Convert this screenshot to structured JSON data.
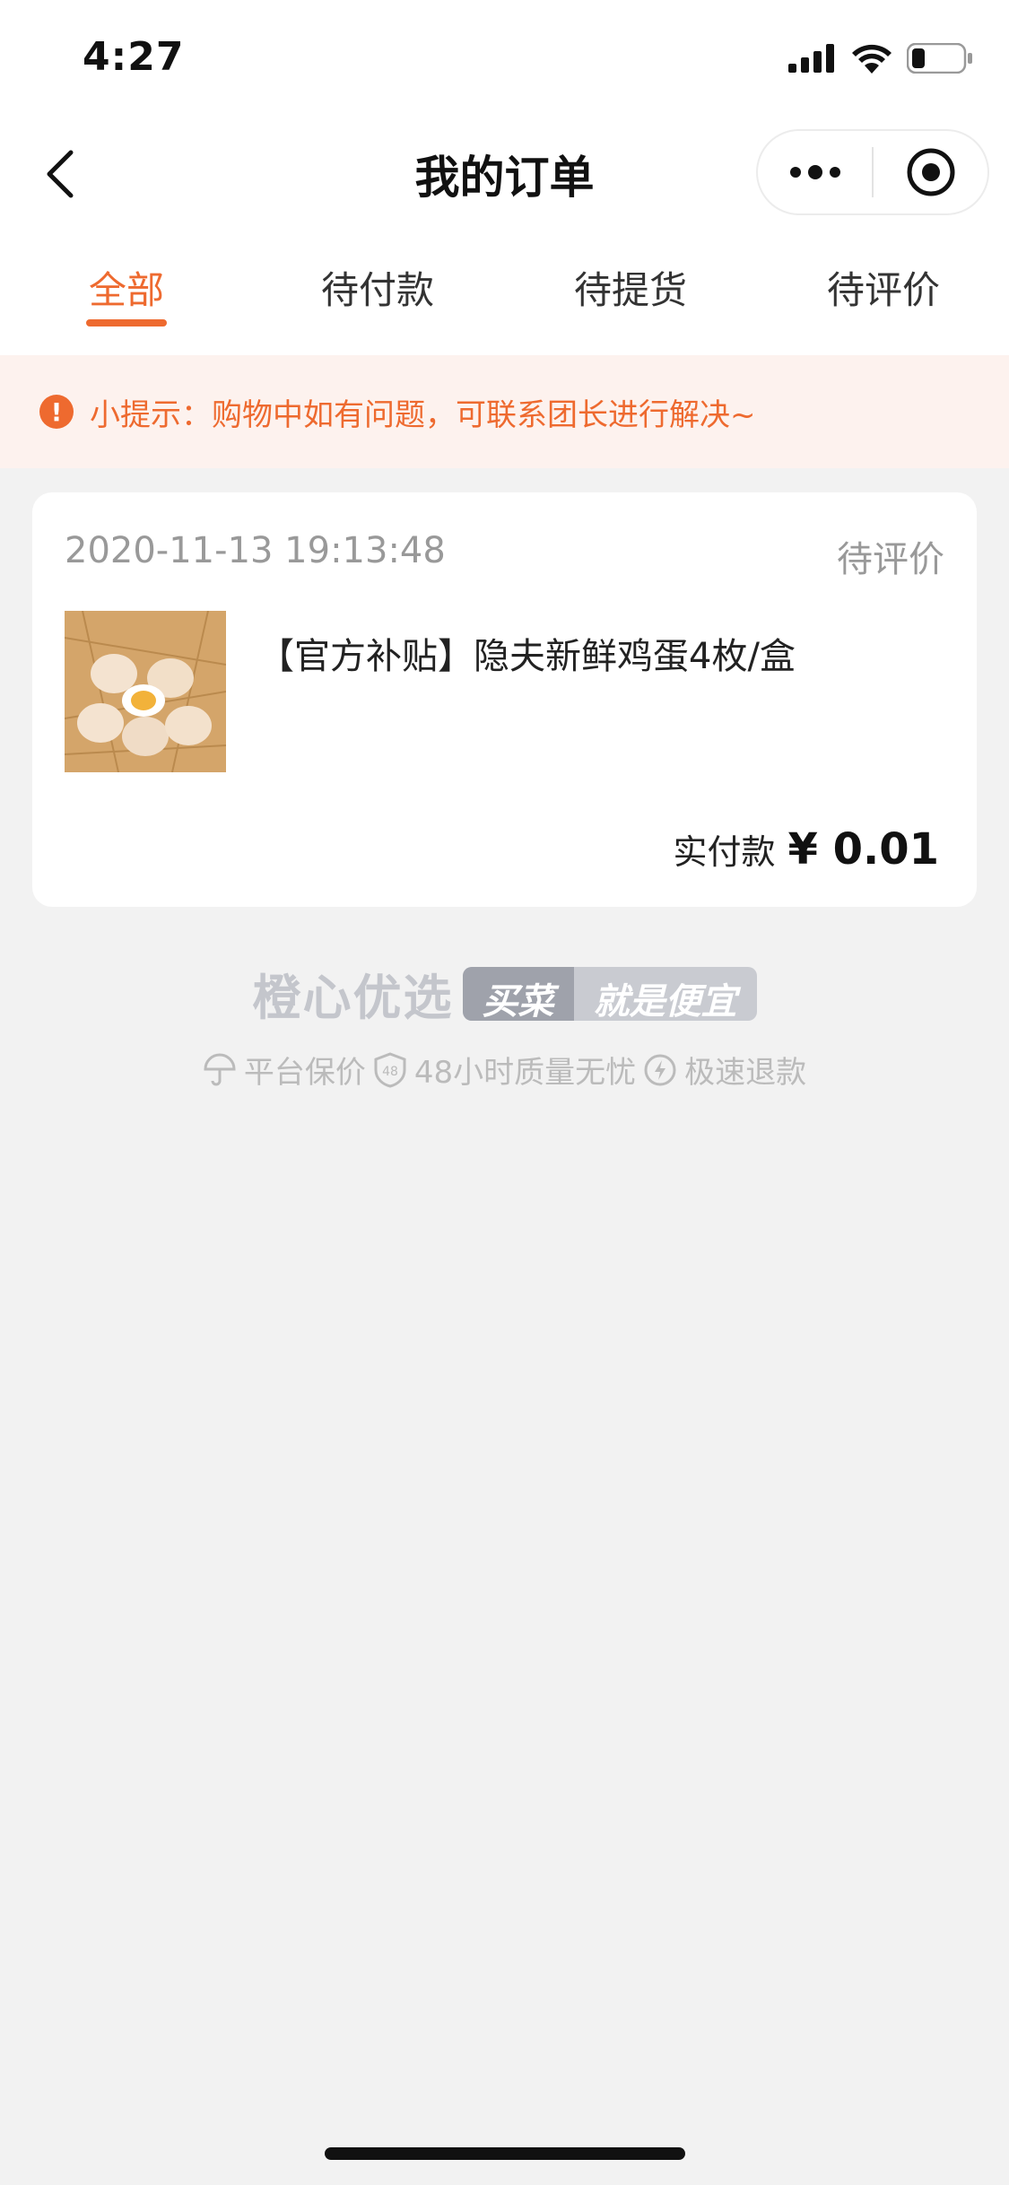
{
  "status_bar": {
    "time": "4:27"
  },
  "nav": {
    "title": "我的订单"
  },
  "tabs": [
    {
      "label": "全部",
      "active": true
    },
    {
      "label": "待付款",
      "active": false
    },
    {
      "label": "待提货",
      "active": false
    },
    {
      "label": "待评价",
      "active": false
    }
  ],
  "tip": {
    "text": "小提示：购物中如有问题，可联系团长进行解决~"
  },
  "order": {
    "datetime": "2020-11-13 19:13:48",
    "status": "待评价",
    "product_name": "【官方补贴】隐夫新鲜鸡蛋4枚/盒",
    "pay_label": "实付款",
    "pay_amount": "¥ 0.01"
  },
  "brand": {
    "name": "橙心优选",
    "slogan_a": "买菜",
    "slogan_b": "就是便宜"
  },
  "guarantees": [
    {
      "icon": "umbrella-icon",
      "label": "平台保价"
    },
    {
      "icon": "shield-48-icon",
      "label": "48小时质量无忧"
    },
    {
      "icon": "lightning-icon",
      "label": "极速退款"
    }
  ],
  "colors": {
    "accent": "#ee6a2f",
    "tip_bg": "#fdf2ee",
    "page_bg": "#f2f2f2"
  }
}
